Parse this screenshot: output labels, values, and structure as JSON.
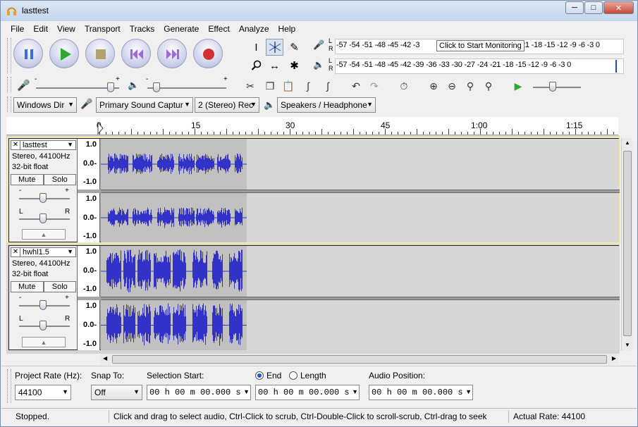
{
  "window": {
    "title": "lasttest"
  },
  "menu": [
    "File",
    "Edit",
    "View",
    "Transport",
    "Tracks",
    "Generate",
    "Effect",
    "Analyze",
    "Help"
  ],
  "meters": {
    "record_scale": "-57 -54 -51 -48 -45 -42 -3",
    "record_scale_tail": "21 -18 -15 -12  -9  -6  -3  0",
    "playback_scale": "-57 -54 -51 -48 -45 -42 -39 -36 -33 -30 -27 -24 -21 -18 -15 -12  -9  -6  -3  0",
    "tooltip": "Click to Start Monitoring",
    "lr_label_l": "L",
    "lr_label_r": "R"
  },
  "mixer": {
    "minus": "-",
    "plus": "+"
  },
  "devices": {
    "host": "Windows Dir",
    "recording_device": "Primary Sound Captur",
    "channels": "2 (Stereo) Rec",
    "playback_device": "Speakers / Headphone"
  },
  "timeline": {
    "labels": [
      "0",
      "15",
      "30",
      "45",
      "1:00",
      "1:15"
    ]
  },
  "tracks": [
    {
      "name": "lasttest",
      "info1": "Stereo, 44100Hz",
      "info2": "32-bit float",
      "mute": "Mute",
      "solo": "Solo",
      "gain_minus": "-",
      "gain_plus": "+",
      "pan_l": "L",
      "pan_r": "R"
    },
    {
      "name": "hwhl1.5",
      "info1": "Stereo, 44100Hz",
      "info2": "32-bit float",
      "mute": "Mute",
      "solo": "Solo",
      "gain_minus": "-",
      "gain_plus": "+",
      "pan_l": "L",
      "pan_r": "R"
    }
  ],
  "vscale": {
    "top": "1.0",
    "mid": "0.0-",
    "bot": "-1.0"
  },
  "selection_bar": {
    "project_rate_label": "Project Rate (Hz):",
    "project_rate_value": "44100",
    "snap_to_label": "Snap To:",
    "snap_to_value": "Off",
    "selection_start_label": "Selection Start:",
    "end_label": "End",
    "length_label": "Length",
    "audio_position_label": "Audio Position:",
    "selection_start_value": "00 h 00 m 00.000 s",
    "end_value": "00 h 00 m 00.000 s",
    "audio_position_value": "00 h 00 m 00.000 s"
  },
  "status": {
    "state": "Stopped.",
    "hint": "Click and drag to select audio, Ctrl-Click to scrub, Ctrl-Double-Click to scroll-scrub, Ctrl-drag to seek",
    "actual_rate": "Actual Rate: 44100"
  },
  "colors": {
    "waveform": "#3232c8",
    "selection": "#c1c1c1",
    "track_bg": "#d7d7d7"
  }
}
